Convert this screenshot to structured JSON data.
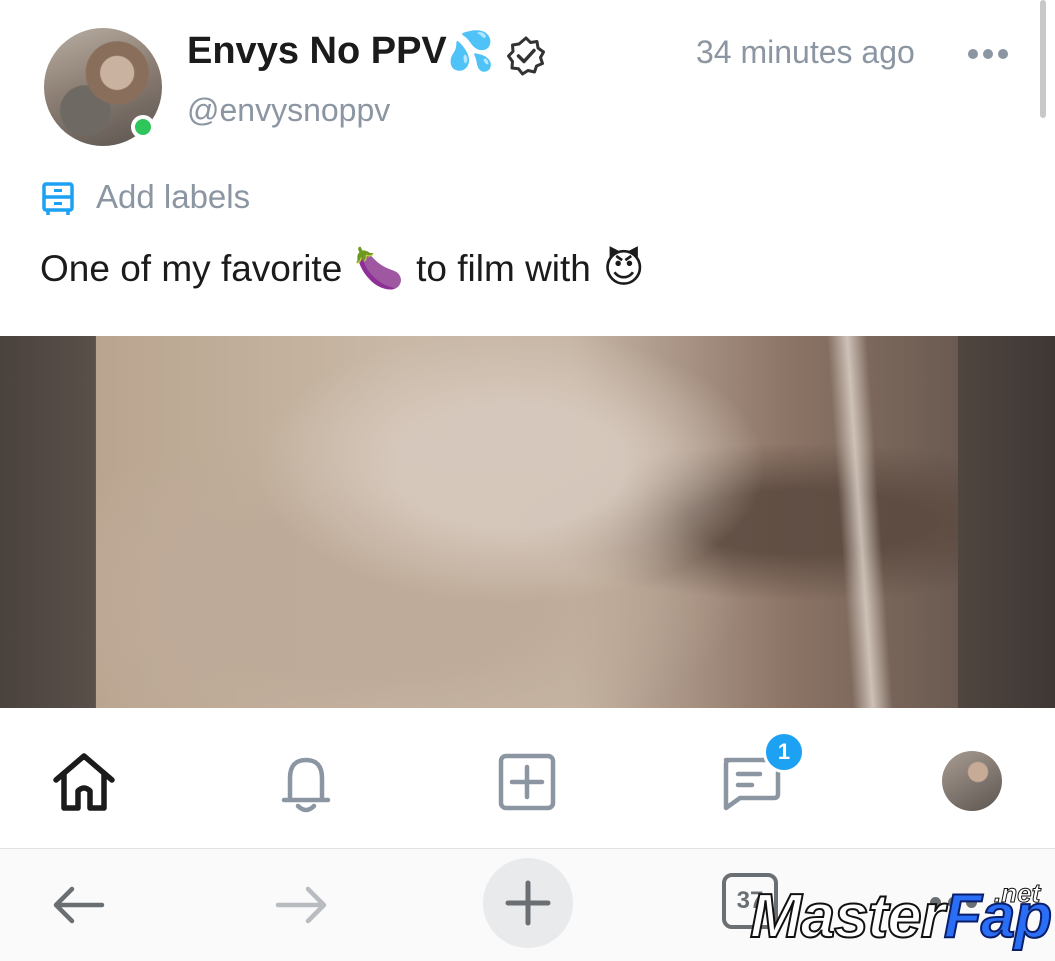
{
  "post": {
    "display_name": "Envys No PPV",
    "name_emoji": "💦",
    "username": "@envysnoppv",
    "timestamp": "34 minutes ago",
    "add_labels": "Add labels",
    "text_part1": "One of my favorite",
    "emoji_1": "🍆",
    "text_part2": "to film with",
    "emoji_2": "😈",
    "online_status_color": "#2ec55a"
  },
  "tabbar": {
    "messages_badge": "1",
    "accent_color": "#1da1f2"
  },
  "browser": {
    "tab_count": "37"
  },
  "watermark": {
    "main": "Master",
    "accent": "Fap",
    "suffix": ".net"
  },
  "icons": {
    "verified": "verified-badge-icon",
    "more": "more-dots-icon",
    "labels": "label-icon",
    "home": "home-icon",
    "notifications": "bell-icon",
    "create": "plus-square-icon",
    "messages": "message-icon",
    "back": "arrow-left-icon",
    "forward": "arrow-right-icon",
    "new_tab": "plus-icon",
    "tabs": "tabs-icon",
    "menu": "menu-dots-icon"
  }
}
